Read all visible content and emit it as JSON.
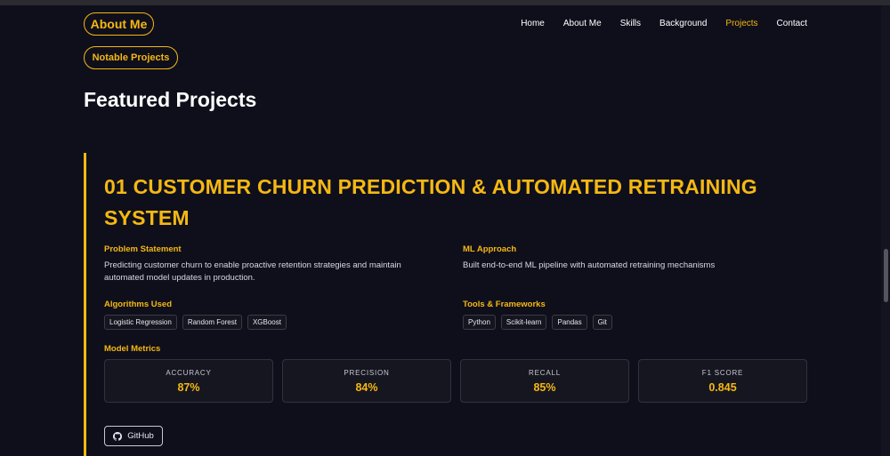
{
  "header": {
    "about_label": "About Me",
    "notable_label": "Notable Projects",
    "nav": [
      {
        "label": "Home"
      },
      {
        "label": "About Me"
      },
      {
        "label": "Skills"
      },
      {
        "label": "Background"
      },
      {
        "label": "Projects"
      },
      {
        "label": "Contact"
      }
    ],
    "active_nav": "Projects"
  },
  "section": {
    "title": "Featured Projects"
  },
  "project": {
    "title": "01 CUSTOMER CHURN PREDICTION & AUTOMATED RETRAINING SYSTEM",
    "problem": {
      "heading": "Problem Statement",
      "text": "Predicting customer churn to enable proactive retention strategies and maintain automated model updates in production."
    },
    "approach": {
      "heading": "ML Approach",
      "text": "Built end-to-end ML pipeline with automated retraining mechanisms"
    },
    "algorithms": {
      "heading": "Algorithms Used",
      "tags": [
        "Logistic Regression",
        "Random Forest",
        "XGBoost"
      ]
    },
    "tools": {
      "heading": "Tools & Frameworks",
      "tags": [
        "Python",
        "Scikit-learn",
        "Pandas",
        "Git"
      ]
    },
    "metrics": {
      "heading": "Model Metrics",
      "items": [
        {
          "label": "ACCURACY",
          "value": "87%"
        },
        {
          "label": "PRECISION",
          "value": "84%"
        },
        {
          "label": "RECALL",
          "value": "85%"
        },
        {
          "label": "F1 SCORE",
          "value": "0.845"
        }
      ]
    },
    "github_label": "GitHub"
  },
  "colors": {
    "accent": "#f5b812",
    "background": "#0f0f1c"
  }
}
